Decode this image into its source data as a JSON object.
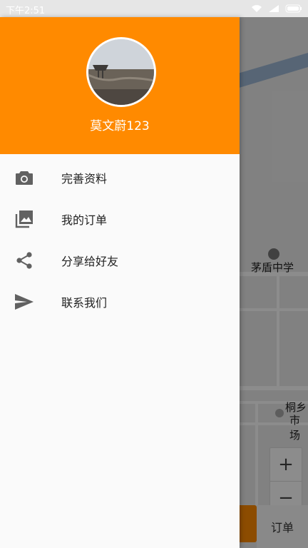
{
  "status_bar": {
    "time": "下午2:51"
  },
  "drawer": {
    "username": "莫文蔚123",
    "menu": [
      {
        "label": "完善资料",
        "icon": "camera-icon"
      },
      {
        "label": "我的订单",
        "icon": "photo-library-icon"
      },
      {
        "label": "分享给好友",
        "icon": "share-icon"
      },
      {
        "label": "联系我们",
        "icon": "send-icon"
      }
    ]
  },
  "map": {
    "poi_1": "茅盾中学",
    "poi_2_line1": "桐乡",
    "poi_2_line2": "市场",
    "zoom_in": "+",
    "zoom_out": "−",
    "order_button": "订单"
  },
  "colors": {
    "accent": "#ff8a00",
    "drawer_bg": "#fafafa"
  }
}
